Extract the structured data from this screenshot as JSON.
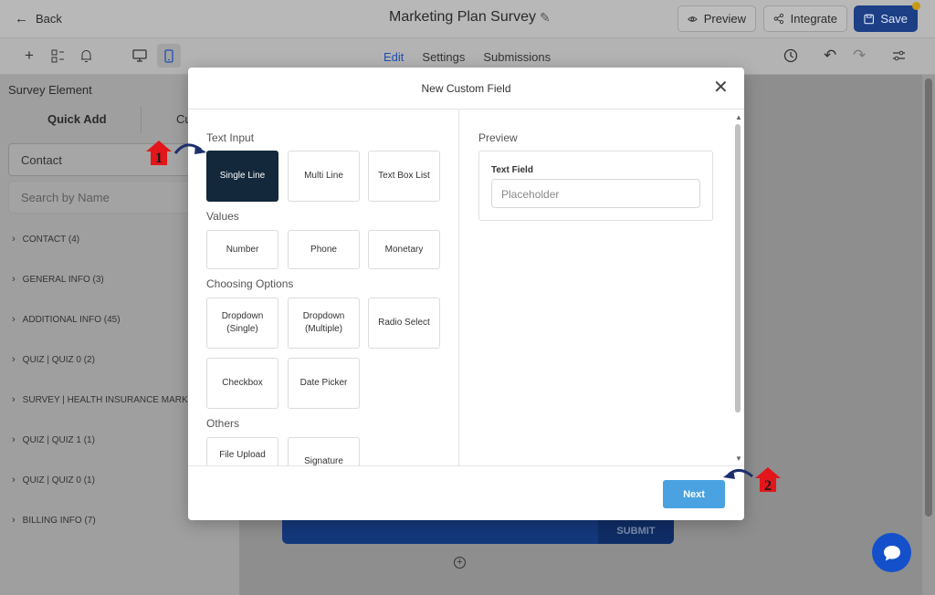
{
  "header": {
    "back_label": "Back",
    "title": "Marketing Plan Survey",
    "preview_label": "Preview",
    "integrate_label": "Integrate",
    "save_label": "Save"
  },
  "toolbar": {
    "tabs": [
      "Edit",
      "Settings",
      "Submissions"
    ],
    "active_tab": "Edit"
  },
  "left_panel": {
    "section_title": "Survey Element",
    "tabs": [
      "Quick Add",
      "Cu"
    ],
    "dropdown_value": "Contact",
    "search_placeholder": "Search by Name",
    "categories": [
      "CONTACT (4)",
      "GENERAL INFO (3)",
      "ADDITIONAL INFO (45)",
      "QUIZ | QUIZ 0 (2)",
      "SURVEY | HEALTH INSURANCE MARKE",
      "QUIZ | QUIZ 1 (1)",
      "QUIZ | QUIZ 0 (1)",
      "BILLING INFO (7)"
    ]
  },
  "canvas": {
    "submit_label": "SUBMIT"
  },
  "modal": {
    "title": "New Custom Field",
    "groups": {
      "text_input": {
        "title": "Text Input",
        "options": [
          "Single Line",
          "Multi Line",
          "Text Box List"
        ]
      },
      "values": {
        "title": "Values",
        "options": [
          "Number",
          "Phone",
          "Monetary"
        ]
      },
      "choosing": {
        "title": "Choosing Options",
        "options": [
          "Dropdown (Single)",
          "Dropdown (Multiple)",
          "Radio Select",
          "Checkbox",
          "Date Picker"
        ]
      },
      "others": {
        "title": "Others",
        "options": [
          "File Upload",
          "Signature"
        ]
      }
    },
    "selected_option": "Single Line",
    "preview": {
      "title": "Preview",
      "field_label": "Text Field",
      "placeholder": "Placeholder"
    },
    "next_label": "Next"
  },
  "annotations": {
    "step1": "1",
    "step2": "2"
  },
  "colors": {
    "save_button": "#1c3f86",
    "selected_option": "#13283a",
    "next_button": "#4aa3e0",
    "annotation_red": "#e3161b",
    "annotation_arrow": "#1d2f6e"
  },
  "icons": [
    "back-arrow-icon",
    "pencil-icon",
    "eye-icon",
    "share-icon",
    "save-icon",
    "plus-icon",
    "element-icon",
    "bell-icon",
    "desktop-icon",
    "mobile-icon",
    "history-icon",
    "undo-icon",
    "redo-icon",
    "filter-icon",
    "chevron-right-icon",
    "close-icon",
    "chat-icon"
  ]
}
